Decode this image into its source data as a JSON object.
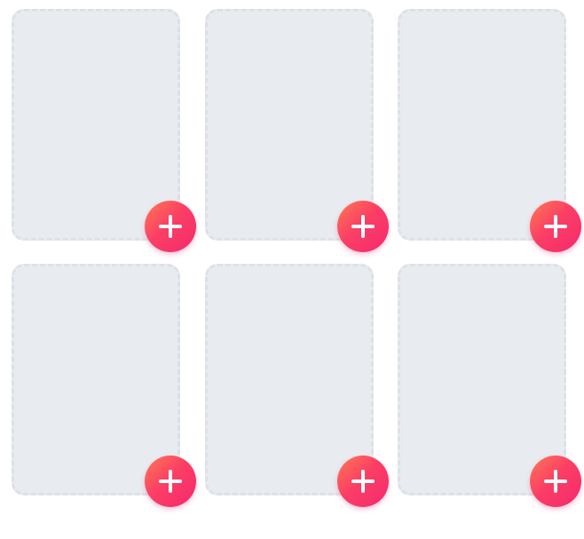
{
  "photo_grid": {
    "slots": [
      {
        "filled": false,
        "add_icon": "plus-icon"
      },
      {
        "filled": false,
        "add_icon": "plus-icon"
      },
      {
        "filled": false,
        "add_icon": "plus-icon"
      },
      {
        "filled": false,
        "add_icon": "plus-icon"
      },
      {
        "filled": false,
        "add_icon": "plus-icon"
      },
      {
        "filled": false,
        "add_icon": "plus-icon"
      }
    ]
  },
  "colors": {
    "slot_background": "#e8ebf0",
    "slot_border": "#dde1e7",
    "accent_gradient_start": "#fe7a55",
    "accent_gradient_end": "#f5296f",
    "icon": "#ffffff"
  }
}
